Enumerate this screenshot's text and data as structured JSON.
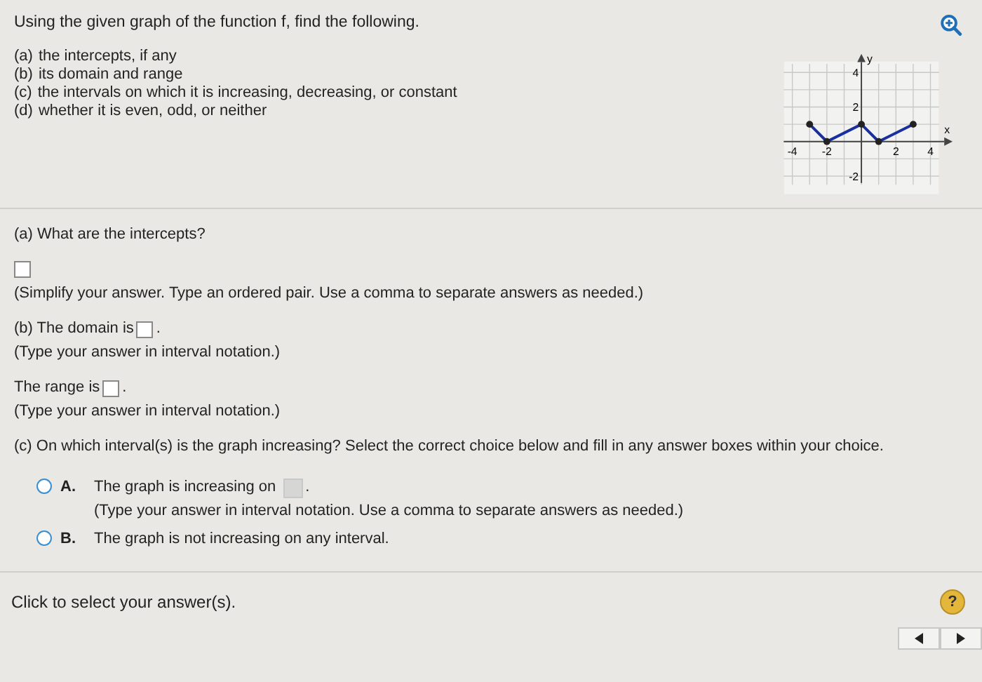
{
  "question": {
    "prompt": "Using the given graph of the function f, find the following.",
    "parts": [
      {
        "letter": "(a)",
        "text": "the intercepts, if any"
      },
      {
        "letter": "(b)",
        "text": "its domain and range"
      },
      {
        "letter": "(c)",
        "text": "the intervals on which it is increasing, decreasing, or constant"
      },
      {
        "letter": "(d)",
        "text": "whether it is even, odd, or neither"
      }
    ],
    "graph": {
      "chart_data": {
        "type": "line",
        "xlabel": "x",
        "ylabel": "y",
        "x": [
          -3,
          -2,
          0,
          1,
          3
        ],
        "series": [
          {
            "color": "#1a2fa0",
            "marker": true,
            "values": [
              1,
              0,
              1,
              0,
              1
            ]
          }
        ],
        "xlim": [
          -4,
          4
        ],
        "ylim": [
          -2,
          4
        ],
        "grid": true,
        "xticks": [
          -4,
          -2,
          2,
          4
        ],
        "yticks": [
          -2,
          2,
          4
        ]
      }
    }
  },
  "answers": {
    "a_prompt": "(a) What are the intercepts?",
    "a_hint": "(Simplify your answer. Type an ordered pair. Use a comma to separate answers as needed.)",
    "b_domain_label": "(b) The domain is",
    "b_domain_after": ".",
    "b_domain_hint": "(Type your answer in interval notation.)",
    "range_label": "The range is",
    "range_after": ".",
    "range_hint": "(Type your answer in interval notation.)",
    "c_prompt": "(c) On which interval(s) is the graph increasing? Select the correct choice below and fill in any answer boxes within your choice.",
    "choices": [
      {
        "letter": "A.",
        "text": "The graph is increasing on",
        "after": ".",
        "hint": "(Type your answer in interval notation. Use a comma to separate answers as needed.)",
        "has_box": true,
        "selected": false
      },
      {
        "letter": "B.",
        "text": "The graph is not increasing on any interval.",
        "has_box": false,
        "selected": false
      }
    ]
  },
  "footer": {
    "instruction": "Click to select your answer(s).",
    "help": "?"
  }
}
